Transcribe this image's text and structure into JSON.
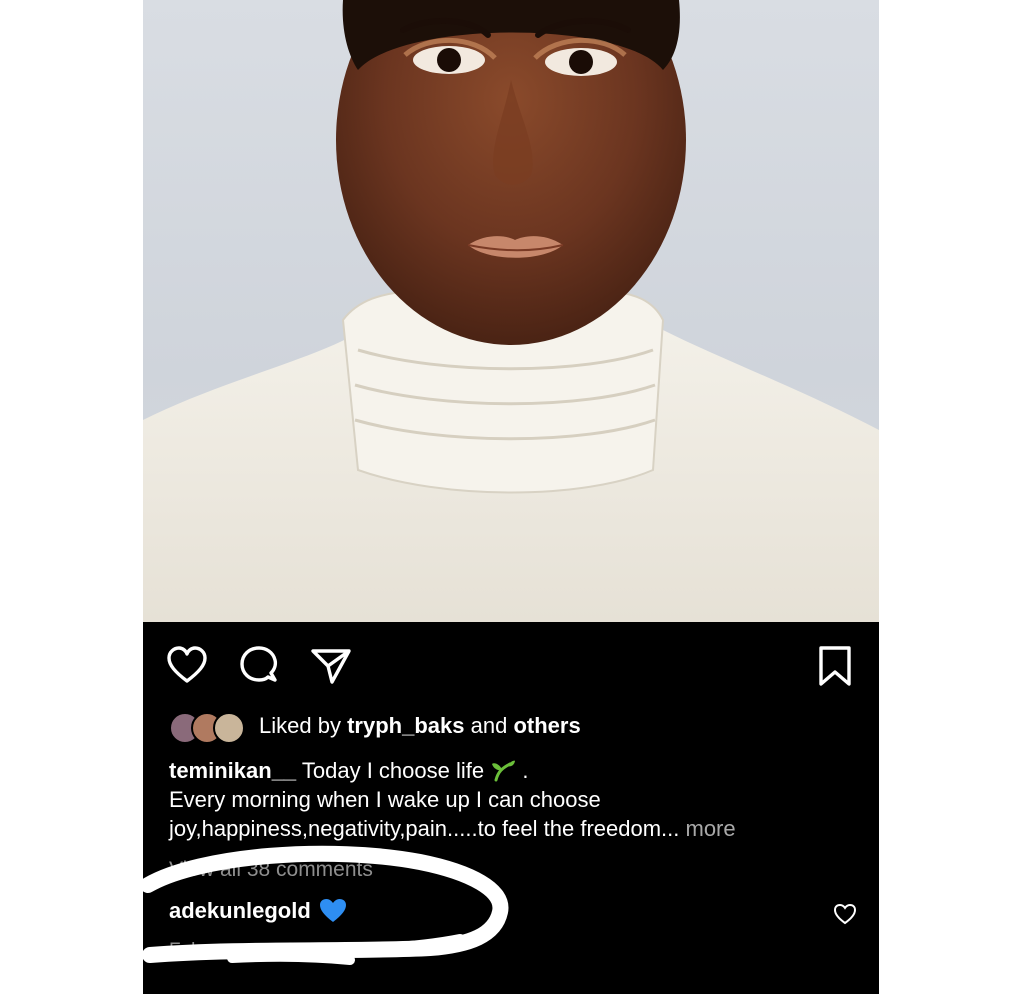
{
  "post": {
    "liked_by_prefix": "Liked by",
    "liked_by_user": "tryph_baks",
    "liked_by_and": "and",
    "liked_by_others": "others",
    "caption_user": "teminikan__",
    "caption_line1": "Today I choose life",
    "caption_line1_end": ".",
    "caption_line2": "Every morning when I wake up I can choose",
    "caption_line3": "joy,happiness,negativity,pain.....to feel the freedom...",
    "more_label": "more",
    "view_all_comments": "View all 38 comments",
    "comment_user": "adekunlegold",
    "date": "February"
  },
  "icons": {
    "like": "heart-outline-icon",
    "comment": "comment-bubble-icon",
    "share": "paper-plane-icon",
    "save": "bookmark-icon",
    "caption_emoji": "seedling-emoji",
    "comment_emoji": "blue-heart-emoji",
    "comment_like": "small-heart-icon"
  },
  "colors": {
    "panel_bg": "#000000",
    "text": "#ffffff",
    "muted": "#8e8e8e",
    "blue_heart": "#2e8ef2",
    "seedling": "#6bbf3a"
  }
}
